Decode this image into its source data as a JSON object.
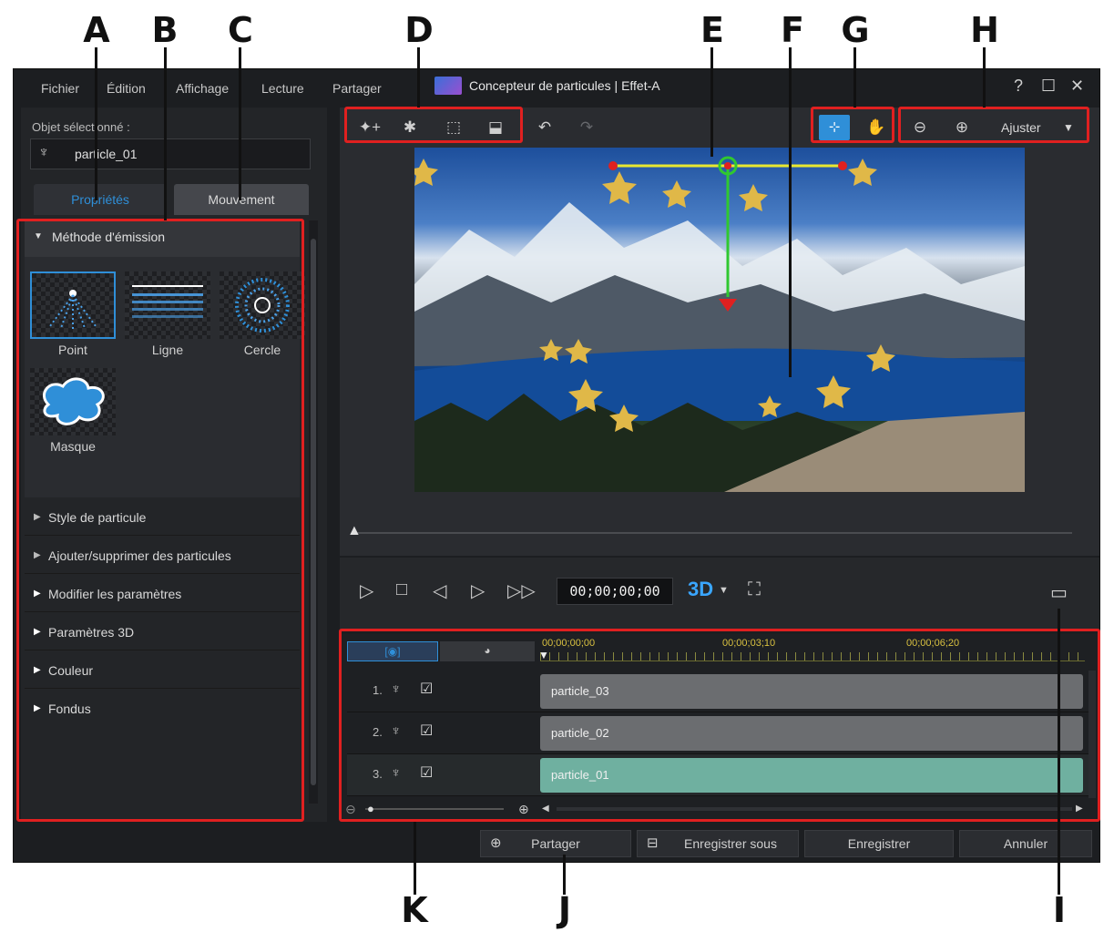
{
  "callouts": {
    "a": "A",
    "b": "B",
    "c": "C",
    "d": "D",
    "e": "E",
    "f": "F",
    "g": "G",
    "h": "H",
    "i": "I",
    "j": "J",
    "k": "K"
  },
  "menu": {
    "file": "Fichier",
    "edit": "Édition",
    "view": "Affichage",
    "play": "Lecture",
    "share": "Partager"
  },
  "title": "Concepteur de particules  |  Effet-A",
  "window_buttons": {
    "help": "?",
    "maximize": "☐",
    "close": "✕"
  },
  "left": {
    "selected_label": "Objet sélectionné :",
    "selected_value": "particle_01",
    "tab_properties": "Propriétés",
    "tab_motion": "Mouvement",
    "emission_header": "Méthode d'émission",
    "emitters": [
      "Point",
      "Ligne",
      "Cercle",
      "Masque"
    ],
    "sections": [
      "Style de particule",
      "Ajouter/supprimer des particules",
      "Modifier les paramètres",
      "Paramètres 3D",
      "Couleur",
      "Fondus"
    ]
  },
  "zoom": {
    "fit_label": "Ajuster"
  },
  "player": {
    "timecode": "00;00;00;00",
    "mode_3d": "3D"
  },
  "timeline": {
    "ticks": [
      "00;00;00;00",
      "00;00;03;10",
      "00;00;06;20"
    ],
    "rows": [
      {
        "num": "1.",
        "clip": "particle_03"
      },
      {
        "num": "2.",
        "clip": "particle_02"
      },
      {
        "num": "3.",
        "clip": "particle_01"
      }
    ]
  },
  "bottom": {
    "share": "Partager",
    "save_as": "Enregistrer sous",
    "save": "Enregistrer",
    "cancel": "Annuler"
  },
  "colors": {
    "accent": "#2f8fd8",
    "callout_box": "#e02020",
    "clip_selected": "#6fb0a0",
    "clip": "#6b6d70"
  }
}
